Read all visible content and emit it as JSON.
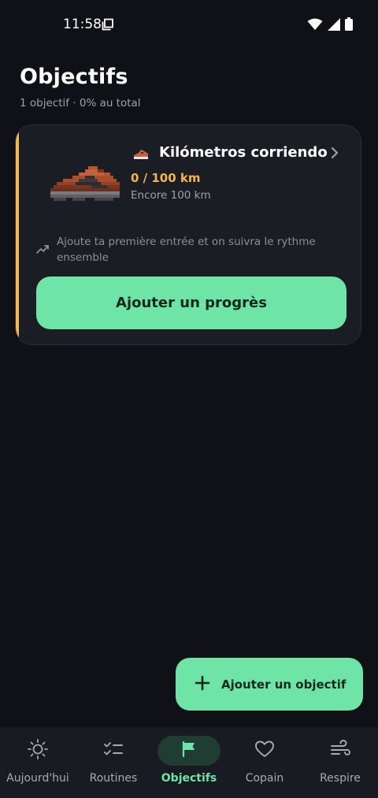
{
  "status_bar": {
    "time": "11:58"
  },
  "header": {
    "title": "Objectifs",
    "subtitle": "1 objectif · 0% au total"
  },
  "goal_card": {
    "name": "Kilómetros corriendo",
    "progress": "0 / 100 km",
    "remaining": "Encore 100 km",
    "hint": "Ajoute ta première entrée et on suivra le rythme ensemble",
    "button_label": "Ajouter un progrès",
    "progress_fraction": 0,
    "accent_color": "#f4b84a"
  },
  "fab": {
    "label": "Ajouter un objectif",
    "icon": "plus-icon"
  },
  "bottom_nav": {
    "items": [
      {
        "label": "Aujourd'hui",
        "icon": "sun-icon"
      },
      {
        "label": "Routines",
        "icon": "checklist-icon"
      },
      {
        "label": "Objectifs",
        "icon": "flag-icon",
        "active": true
      },
      {
        "label": "Copain",
        "icon": "heart-icon"
      },
      {
        "label": "Respire",
        "icon": "wind-icon"
      }
    ]
  },
  "colors": {
    "background": "#101116",
    "accent_green": "#6ee5a6",
    "accent_orange": "#f1b749",
    "card": "#1b1d24"
  }
}
